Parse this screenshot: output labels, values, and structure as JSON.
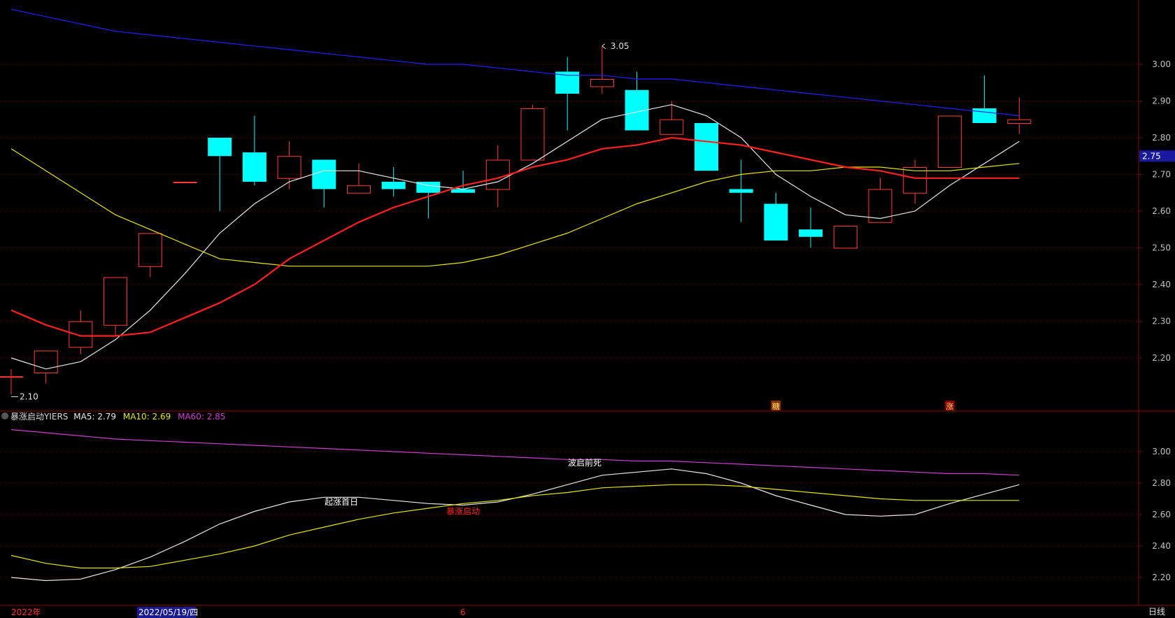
{
  "colors": {
    "up": "#ff3c3c",
    "down": "#00ffff",
    "ma5": "#e8e8e8",
    "ma10": "#e6e600",
    "ma20": "#ff2020",
    "ma60": "#2020ff",
    "grid": "#8a0000",
    "axis_text": "#c0c0c0",
    "current_price_bg": "#1a1aa0",
    "indicator_ma60": "#d23cd2"
  },
  "chart_data": [
    {
      "type": "candlestick",
      "panel": "main",
      "ylim": [
        2.1,
        3.15
      ],
      "yticks": [
        "3.00",
        "2.90",
        "2.80",
        "2.70",
        "2.60",
        "2.50",
        "2.40",
        "2.30",
        "2.20"
      ],
      "ohlc": [
        {
          "o": 2.15,
          "h": 2.17,
          "l": 2.1,
          "c": 2.15
        },
        {
          "o": 2.16,
          "h": 2.22,
          "l": 2.13,
          "c": 2.22
        },
        {
          "o": 2.23,
          "h": 2.33,
          "l": 2.21,
          "c": 2.3
        },
        {
          "o": 2.29,
          "h": 2.42,
          "l": 2.26,
          "c": 2.42
        },
        {
          "o": 2.45,
          "h": 2.54,
          "l": 2.42,
          "c": 2.54
        },
        {
          "o": 2.68,
          "h": 2.68,
          "l": 2.68,
          "c": 2.68
        },
        {
          "o": 2.8,
          "h": 2.8,
          "l": 2.6,
          "c": 2.75
        },
        {
          "o": 2.76,
          "h": 2.86,
          "l": 2.67,
          "c": 2.68
        },
        {
          "o": 2.69,
          "h": 2.79,
          "l": 2.66,
          "c": 2.75
        },
        {
          "o": 2.74,
          "h": 2.74,
          "l": 2.61,
          "c": 2.66
        },
        {
          "o": 2.65,
          "h": 2.73,
          "l": 2.65,
          "c": 2.67
        },
        {
          "o": 2.68,
          "h": 2.72,
          "l": 2.64,
          "c": 2.66
        },
        {
          "o": 2.68,
          "h": 2.68,
          "l": 2.58,
          "c": 2.65
        },
        {
          "o": 2.66,
          "h": 2.71,
          "l": 2.65,
          "c": 2.65
        },
        {
          "o": 2.66,
          "h": 2.78,
          "l": 2.61,
          "c": 2.74
        },
        {
          "o": 2.74,
          "h": 2.89,
          "l": 2.74,
          "c": 2.88
        },
        {
          "o": 2.98,
          "h": 3.02,
          "l": 2.82,
          "c": 2.92
        },
        {
          "o": 2.94,
          "h": 3.05,
          "l": 2.92,
          "c": 2.96
        },
        {
          "o": 2.93,
          "h": 2.98,
          "l": 2.82,
          "c": 2.82
        },
        {
          "o": 2.81,
          "h": 2.9,
          "l": 2.81,
          "c": 2.85
        },
        {
          "o": 2.84,
          "h": 2.84,
          "l": 2.71,
          "c": 2.71
        },
        {
          "o": 2.66,
          "h": 2.74,
          "l": 2.57,
          "c": 2.65
        },
        {
          "o": 2.62,
          "h": 2.65,
          "l": 2.52,
          "c": 2.52
        },
        {
          "o": 2.55,
          "h": 2.61,
          "l": 2.5,
          "c": 2.53
        },
        {
          "o": 2.5,
          "h": 2.56,
          "l": 2.5,
          "c": 2.56
        },
        {
          "o": 2.57,
          "h": 2.69,
          "l": 2.57,
          "c": 2.66
        },
        {
          "o": 2.65,
          "h": 2.74,
          "l": 2.62,
          "c": 2.72
        },
        {
          "o": 2.72,
          "h": 2.86,
          "l": 2.72,
          "c": 2.86
        },
        {
          "o": 2.88,
          "h": 2.97,
          "l": 2.84,
          "c": 2.84
        },
        {
          "o": 2.84,
          "h": 2.91,
          "l": 2.81,
          "c": 2.85
        }
      ],
      "series": [
        {
          "key": "ma5",
          "values": [
            2.2,
            2.17,
            2.19,
            2.25,
            2.33,
            2.43,
            2.54,
            2.62,
            2.68,
            2.71,
            2.71,
            2.69,
            2.67,
            2.66,
            2.68,
            2.73,
            2.79,
            2.85,
            2.87,
            2.89,
            2.86,
            2.8,
            2.7,
            2.64,
            2.59,
            2.58,
            2.6,
            2.67,
            2.73,
            2.79
          ]
        },
        {
          "key": "ma10",
          "values": [
            2.77,
            2.71,
            2.65,
            2.59,
            2.55,
            2.51,
            2.47,
            2.46,
            2.45,
            2.45,
            2.45,
            2.45,
            2.45,
            2.46,
            2.48,
            2.51,
            2.54,
            2.58,
            2.62,
            2.65,
            2.68,
            2.7,
            2.71,
            2.71,
            2.72,
            2.72,
            2.71,
            2.71,
            2.72,
            2.73
          ]
        },
        {
          "key": "ma20",
          "values": [
            2.33,
            2.29,
            2.26,
            2.26,
            2.27,
            2.31,
            2.35,
            2.4,
            2.47,
            2.52,
            2.57,
            2.61,
            2.64,
            2.67,
            2.69,
            2.72,
            2.74,
            2.77,
            2.78,
            2.8,
            2.79,
            2.78,
            2.76,
            2.74,
            2.72,
            2.71,
            2.69,
            2.69,
            2.69,
            2.69
          ]
        },
        {
          "key": "ma60",
          "values": [
            3.15,
            3.13,
            3.11,
            3.09,
            3.08,
            3.07,
            3.06,
            3.05,
            3.04,
            3.03,
            3.02,
            3.01,
            3.0,
            3.0,
            2.99,
            2.98,
            2.97,
            2.97,
            2.96,
            2.96,
            2.95,
            2.94,
            2.93,
            2.92,
            2.91,
            2.9,
            2.89,
            2.88,
            2.87,
            2.86
          ]
        }
      ],
      "annotations": {
        "high_label": "3.05",
        "low_label": "2.10",
        "current_price": "2.75",
        "signal_1": "糖",
        "signal_2": "涨"
      }
    },
    {
      "type": "line",
      "panel": "indicator",
      "ylim": [
        2.13,
        3.13
      ],
      "yticks": [
        "3.00",
        "2.80",
        "2.60",
        "2.40",
        "2.20"
      ],
      "series": [
        {
          "name": "MA5",
          "key": "ma5",
          "values": [
            2.2,
            2.18,
            2.19,
            2.25,
            2.33,
            2.43,
            2.54,
            2.62,
            2.68,
            2.71,
            2.71,
            2.69,
            2.67,
            2.66,
            2.68,
            2.73,
            2.79,
            2.85,
            2.87,
            2.89,
            2.86,
            2.8,
            2.72,
            2.66,
            2.6,
            2.59,
            2.6,
            2.67,
            2.73,
            2.79
          ]
        },
        {
          "name": "MA10",
          "key": "ma10",
          "values": [
            2.34,
            2.29,
            2.26,
            2.26,
            2.27,
            2.31,
            2.35,
            2.4,
            2.47,
            2.52,
            2.57,
            2.61,
            2.64,
            2.67,
            2.69,
            2.72,
            2.74,
            2.77,
            2.78,
            2.79,
            2.79,
            2.78,
            2.76,
            2.74,
            2.72,
            2.7,
            2.69,
            2.69,
            2.69,
            2.69
          ]
        },
        {
          "name": "MA60",
          "key": "indicator_ma60",
          "values": [
            3.14,
            3.12,
            3.1,
            3.08,
            3.07,
            3.06,
            3.05,
            3.04,
            3.03,
            3.02,
            3.01,
            3.0,
            2.99,
            2.98,
            2.97,
            2.96,
            2.95,
            2.95,
            2.94,
            2.94,
            2.93,
            2.92,
            2.91,
            2.9,
            2.89,
            2.88,
            2.87,
            2.86,
            2.86,
            2.85
          ]
        }
      ],
      "labels": [
        {
          "text": "起涨首日",
          "index": 9.5,
          "value": 2.68,
          "color": "#ffffff"
        },
        {
          "text": "暴涨启动",
          "index": 13.0,
          "value": 2.62,
          "color": "#ff2020"
        },
        {
          "text": "波启前死",
          "index": 16.5,
          "value": 2.93,
          "color": "#ffffff"
        }
      ],
      "legend": {
        "name": "暴涨启动YIERS",
        "ma5_text": "MA5: 2.79",
        "ma10_text": "MA10: 2.69",
        "ma60_text": "MA60: 2.85"
      }
    }
  ],
  "footer": {
    "year_label": "2022年",
    "date_label": "2022/05/19/四",
    "month_label": "6",
    "period_label": "日线"
  }
}
